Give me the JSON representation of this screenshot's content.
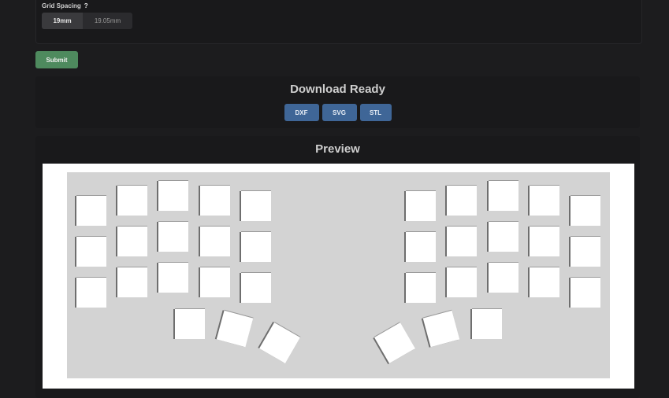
{
  "settings": {
    "grid_spacing_label": "Grid Spacing",
    "help_icon_glyph": "?",
    "grid_spacing_options": [
      "19mm",
      "19.05mm"
    ],
    "grid_spacing_selected": "19mm"
  },
  "submit_label": "Submit",
  "download": {
    "title": "Download Ready",
    "buttons": [
      "DXF",
      "SVG",
      "STL"
    ]
  },
  "preview": {
    "title": "Preview",
    "left_hand_keys": 18,
    "right_hand_keys": 18
  },
  "colors": {
    "background": "#1c1c1e",
    "submit_green": "#4e8a5e",
    "download_blue": "#3f6697",
    "plate_gray": "#d3d3d3",
    "key_white": "#ffffff"
  }
}
